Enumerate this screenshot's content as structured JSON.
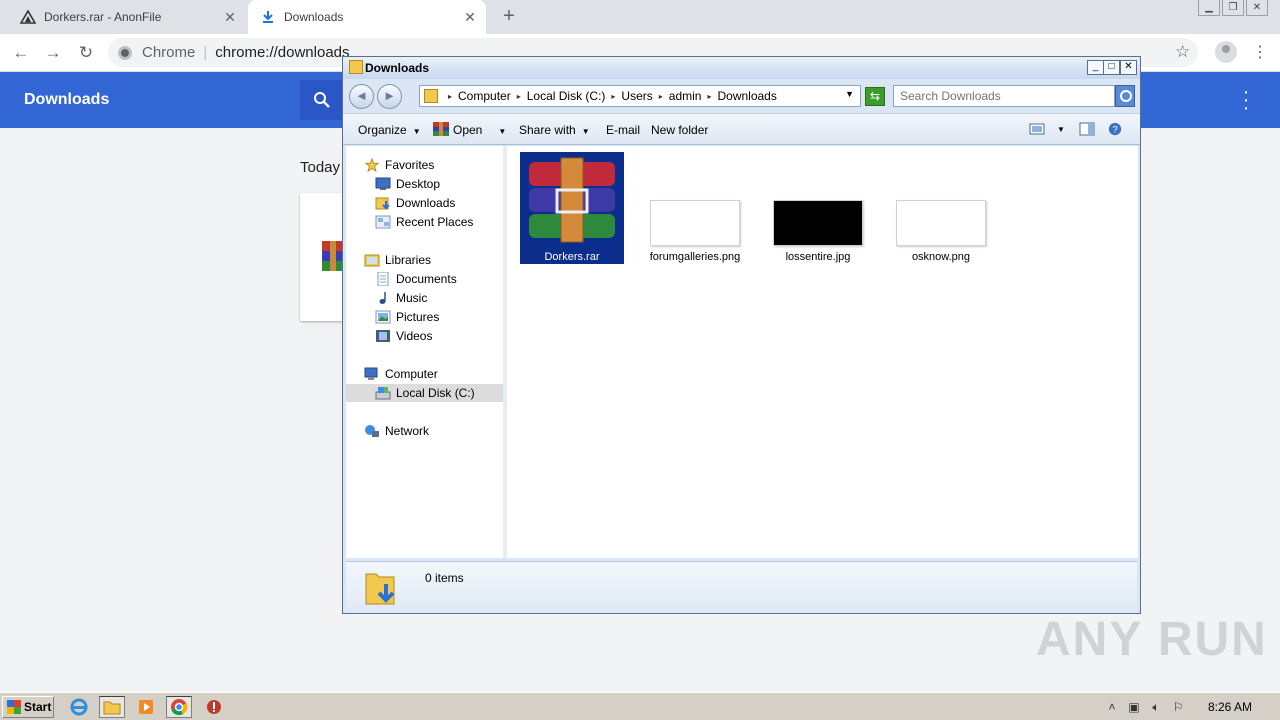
{
  "browser": {
    "tabs": [
      {
        "title": "Dorkers.rar - AnonFile",
        "close": "✕"
      },
      {
        "title": "Downloads",
        "close": "✕"
      }
    ],
    "new_tab": "+",
    "omnibox": {
      "scheme": "Chrome",
      "separator": "|",
      "url": "chrome://downloads"
    }
  },
  "downloads_page": {
    "title": "Downloads",
    "section_label": "Today"
  },
  "explorer": {
    "window_title": "Downloads",
    "window_buttons": {
      "minimize": "_",
      "maximize": "□",
      "close": "✕"
    },
    "breadcrumb": [
      "Computer",
      "Local Disk (C:)",
      "Users",
      "admin",
      "Downloads"
    ],
    "search_placeholder": "Search Downloads",
    "commands": {
      "organize": "Organize",
      "open": "Open",
      "share_with": "Share with",
      "email": "E-mail",
      "new_folder": "New folder"
    },
    "nav": {
      "favorites": "Favorites",
      "desktop": "Desktop",
      "downloads": "Downloads",
      "recent_places": "Recent Places",
      "libraries": "Libraries",
      "documents": "Documents",
      "music": "Music",
      "pictures": "Pictures",
      "videos": "Videos",
      "computer": "Computer",
      "local_disk": "Local Disk (C:)",
      "network": "Network"
    },
    "files": [
      {
        "name": "Dorkers.rar",
        "selected": true
      },
      {
        "name": "forumgalleries.png",
        "selected": false
      },
      {
        "name": "lossentire.jpg",
        "selected": false
      },
      {
        "name": "osknow.png",
        "selected": false
      }
    ],
    "details": {
      "item_count": "0 items"
    }
  },
  "watermark": "ANY RUN",
  "taskbar": {
    "start_label": "Start",
    "clock": "8:26 AM"
  },
  "colors": {
    "chrome_blue": "#3367d6",
    "selection": "#0b2e8c"
  }
}
